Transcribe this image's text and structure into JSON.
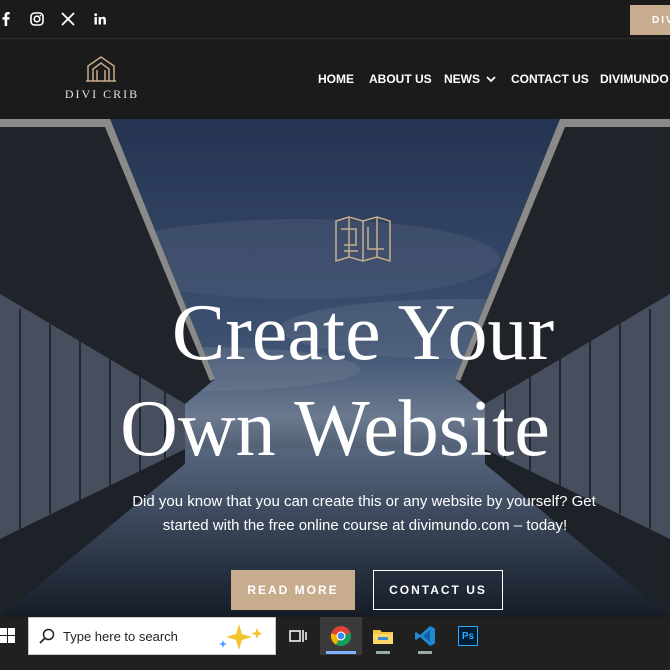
{
  "social": {
    "facebook": "facebook-icon",
    "instagram": "instagram-icon",
    "twitter": "x-twitter-icon",
    "linkedin": "linkedin-icon"
  },
  "top_cta": {
    "label": "DIVI"
  },
  "brand": {
    "name": "DIVI CRIB"
  },
  "nav": {
    "items": [
      {
        "label": "HOME"
      },
      {
        "label": "ABOUT US"
      },
      {
        "label": "NEWS"
      },
      {
        "label": "CONTACT US"
      },
      {
        "label": "DIVIMUNDO"
      }
    ]
  },
  "hero": {
    "headline_line1": "Create Your",
    "headline_line2": "Own Website",
    "subtext_line1": "Did you know that you can create this or any website by yourself? Get",
    "subtext_line2": "started with the free online course at divimundo.com – today!",
    "read_more": "READ MORE",
    "contact": "CONTACT US"
  },
  "taskbar": {
    "search_placeholder": "Type here to search"
  },
  "colors": {
    "accent": "#c7ad8e",
    "header_bg": "#1b1b1b"
  }
}
